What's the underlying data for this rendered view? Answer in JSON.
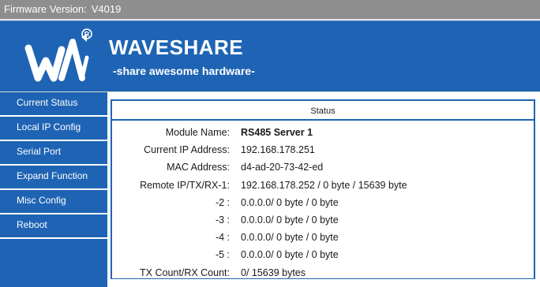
{
  "topbar": {
    "firmware_label": "Firmware Version:",
    "firmware_value": "V4019"
  },
  "header": {
    "brand": "WAVESHARE",
    "slogan": "-share awesome hardware-",
    "logo_icon": "waveshare-logo-icon",
    "colors": {
      "brand_blue": "#1f64b4",
      "topbar_gray": "#8e8e8e"
    }
  },
  "sidebar": {
    "items": [
      {
        "label": "Current Status"
      },
      {
        "label": "Local IP Config"
      },
      {
        "label": "Serial Port"
      },
      {
        "label": "Expand Function"
      },
      {
        "label": "Misc Config"
      },
      {
        "label": "Reboot"
      }
    ]
  },
  "status": {
    "title": "Status",
    "rows": [
      {
        "label": "Module Name:",
        "value": "RS485 Server 1"
      },
      {
        "label": "Current IP Address:",
        "value": "192.168.178.251"
      },
      {
        "label": "MAC Address:",
        "value": "d4-ad-20-73-42-ed"
      },
      {
        "label": "Remote IP/TX/RX-1:",
        "value": "192.168.178.252 / 0 byte / 15639 byte"
      },
      {
        "label": "-2 :",
        "value": "0.0.0.0/ 0 byte / 0 byte"
      },
      {
        "label": "-3 :",
        "value": "0.0.0.0/ 0 byte / 0 byte"
      },
      {
        "label": "-4 :",
        "value": "0.0.0.0/ 0 byte / 0 byte"
      },
      {
        "label": "-5 :",
        "value": "0.0.0.0/ 0 byte / 0 byte"
      },
      {
        "label": "TX Count/RX Count:",
        "value": "0/ 15639 bytes"
      }
    ]
  }
}
